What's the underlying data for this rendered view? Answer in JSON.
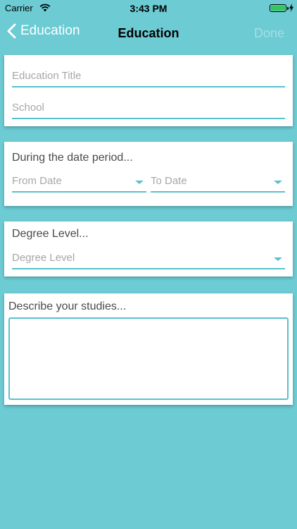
{
  "status_bar": {
    "carrier": "Carrier",
    "time": "3:43 PM"
  },
  "nav": {
    "back_label": "Education",
    "title": "Education",
    "done_label": "Done"
  },
  "form": {
    "education_title_placeholder": "Education Title",
    "school_placeholder": "School",
    "date_section_heading": "During the date period...",
    "from_date_placeholder": "From Date",
    "to_date_placeholder": "To Date",
    "degree_section_heading": "Degree Level...",
    "degree_level_placeholder": "Degree Level",
    "studies_heading": "Describe your studies..."
  },
  "colors": {
    "background": "#6ccbd3",
    "accent": "#57c2cb",
    "done_disabled": "#a6dfe4",
    "battery": "#34c759"
  },
  "icons": [
    "wifi-icon",
    "battery-icon",
    "charging-bolt-icon",
    "back-chevron-icon",
    "dropdown-caret-icon"
  ]
}
